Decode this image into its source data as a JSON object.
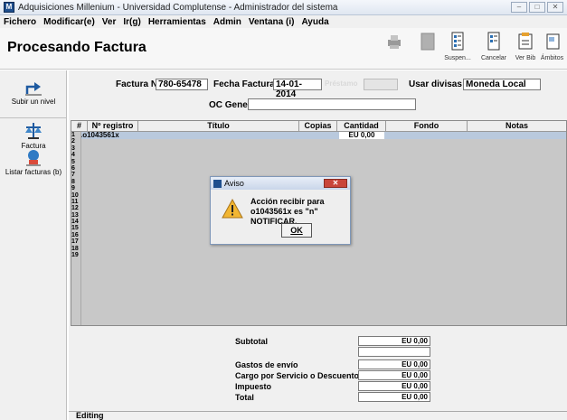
{
  "window": {
    "title": "Adquisiciones Millenium - Universidad Complutense - Administrador del sistema",
    "controls": [
      "–",
      "□",
      "✕"
    ]
  },
  "menu": [
    "Fichero",
    "Modificar(e)",
    "Ver",
    "Ir(g)",
    "Herramientas",
    "Admin",
    "Ventana (i)",
    "Ayuda"
  ],
  "header": {
    "page_title": "Procesando Factura",
    "toolbar": [
      {
        "label": "",
        "icon": "printer-icon",
        "disabled": true
      },
      {
        "label": "",
        "icon": "blank-doc-icon",
        "disabled": true
      },
      {
        "label": "Suspen...",
        "icon": "suspend-icon",
        "disabled": false
      },
      {
        "label": "Cancelar",
        "icon": "cancel-icon",
        "disabled": false
      },
      {
        "label": "Ver Bib",
        "icon": "view-bib-icon",
        "disabled": false
      },
      {
        "label": "Ámbitos",
        "icon": "scopes-icon",
        "disabled": false
      }
    ]
  },
  "left_panel": [
    {
      "label": "Subir un nivel",
      "icon": "up-level-icon"
    },
    {
      "label": "Factura",
      "icon": "invoice-icon"
    },
    {
      "label": "Listar facturas (b)",
      "icon": "list-invoices-icon"
    }
  ],
  "form": {
    "factura_label": "Factura Nº",
    "factura_value": "780-65478",
    "fecha_label": "Fecha Factura",
    "fecha_value": "14-01-2014",
    "hidden_label": "Préstamo",
    "divisas_label": "Usar divisas",
    "divisas_value": "Moneda Local",
    "oc_label": "OC General:",
    "oc_value": ""
  },
  "grid": {
    "columns": [
      "#",
      "Nº registro",
      "Título",
      "Copias",
      "Cantidad",
      "Fondo",
      "Notas"
    ],
    "rows": [
      "1",
      "2",
      "3",
      "4",
      "5",
      "6",
      "7",
      "8",
      "9",
      "10",
      "11",
      "12",
      "13",
      "14",
      "15",
      "16",
      "17",
      "18",
      "19"
    ],
    "row1_registro": ".o1043561x",
    "row1_cantidad": "EU 0,00"
  },
  "totals": {
    "subtotal_label": "Subtotal",
    "subtotal_value": "EU 0,00",
    "gastos_label": "Gastos de envío",
    "gastos_value": "EU 0,00",
    "cargo_label": "Cargo por Servicio o Descuento",
    "cargo_value": "EU 0,00",
    "impuesto_label": "Impuesto",
    "impuesto_value": "EU 0,00",
    "total_label": "Total",
    "total_value": "EU 0,00"
  },
  "status": "Editing",
  "dialog": {
    "title": "Aviso",
    "message": "Acción recibir para o1043561x es \"n\" NOTIFICAR.",
    "ok_label": "OK"
  }
}
